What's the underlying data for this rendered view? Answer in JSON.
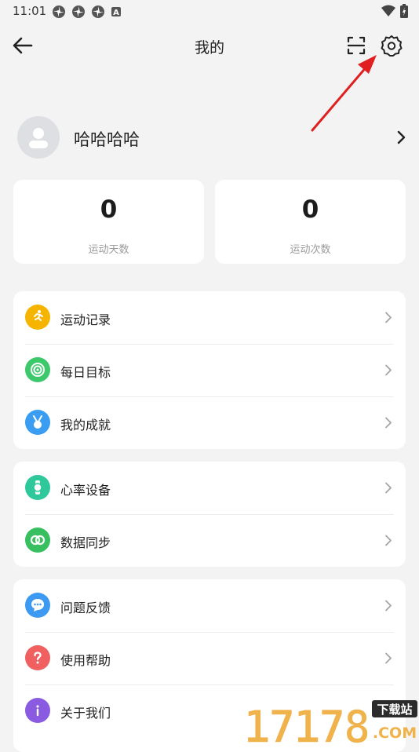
{
  "status_bar": {
    "time": "11:01",
    "notification_icons": [
      "pinwheel-icon",
      "pinwheel-icon",
      "pinwheel-icon",
      "a-badge-icon"
    ],
    "notification_badge_text": "A",
    "right_icons": [
      "wifi-icon",
      "battery-icon"
    ]
  },
  "header": {
    "title": "我的",
    "back_icon": "arrow-left-icon",
    "scan_icon": "scan-icon",
    "settings_icon": "gear-icon"
  },
  "profile": {
    "username": "哈哈哈哈"
  },
  "stats": [
    {
      "value": "0",
      "label": "运动天数"
    },
    {
      "value": "0",
      "label": "运动次数"
    }
  ],
  "menu_groups": [
    [
      {
        "label": "运动记录",
        "icon": "running-icon",
        "color": "#f5b400"
      },
      {
        "label": "每日目标",
        "icon": "target-icon",
        "color": "#3dc96b"
      },
      {
        "label": "我的成就",
        "icon": "medal-icon",
        "color": "#3a9df2"
      }
    ],
    [
      {
        "label": "心率设备",
        "icon": "watch-icon",
        "color": "#2fc89a"
      },
      {
        "label": "数据同步",
        "icon": "sync-rings-icon",
        "color": "#38c060"
      }
    ],
    [
      {
        "label": "问题反馈",
        "icon": "chat-icon",
        "color": "#3d9af2"
      },
      {
        "label": "使用帮助",
        "icon": "question-icon",
        "color": "#f06060"
      },
      {
        "label": "关于我们",
        "icon": "info-icon",
        "color": "#8a5be0"
      }
    ]
  ],
  "watermark": {
    "number": "17178",
    "site_text": "下载站",
    "domain_text": ".COM"
  },
  "colors": {
    "background": "#f3f3f4",
    "card": "#ffffff",
    "annotation_arrow": "#e02020",
    "watermark_number": "#f0b24a",
    "watermark_tag": "#2b2b2b"
  }
}
